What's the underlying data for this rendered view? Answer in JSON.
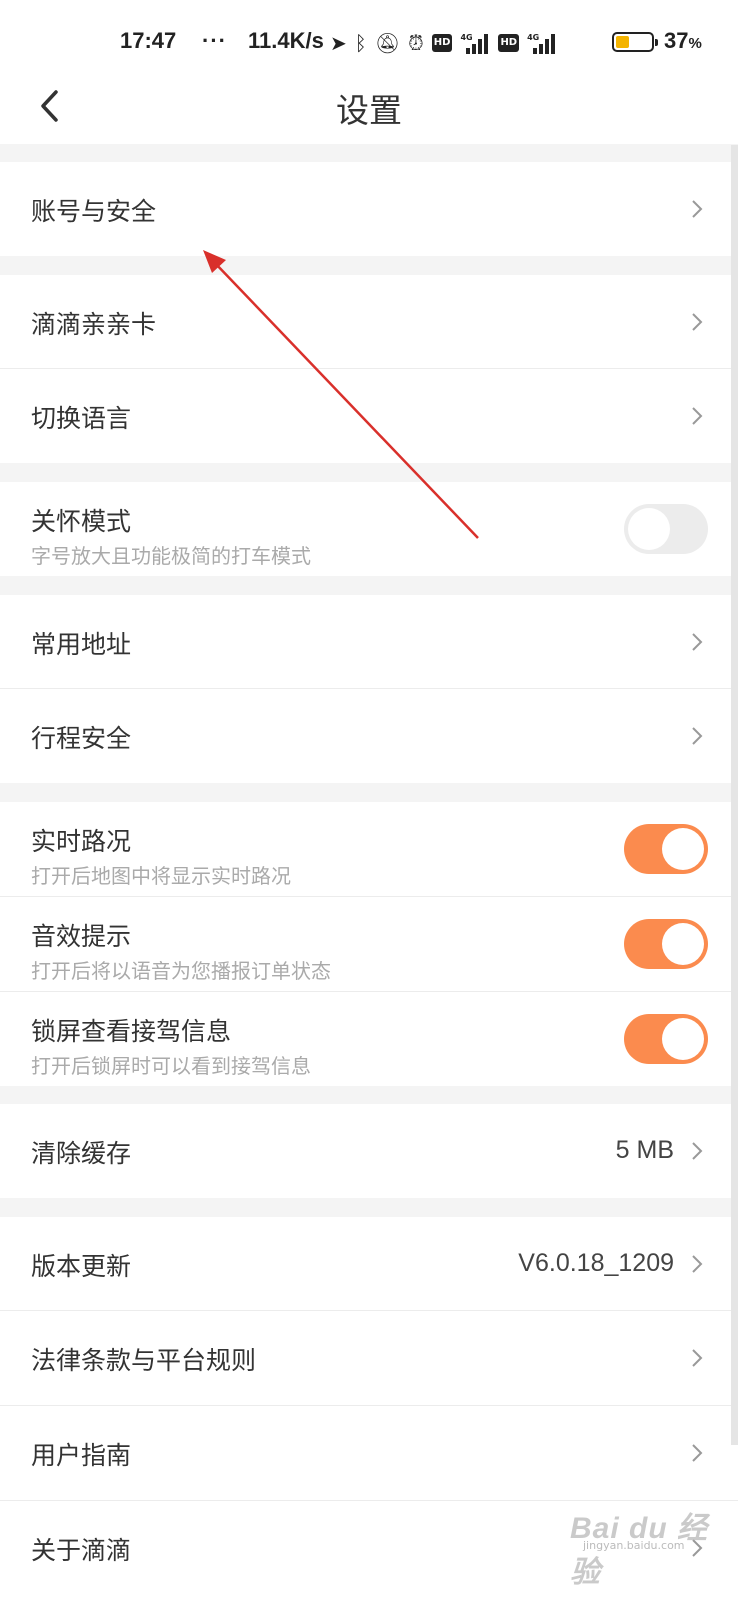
{
  "status_bar": {
    "time": "17:47",
    "dots": "···",
    "net_speed": "11.4K/s",
    "net_type_1": "4G",
    "net_type_2": "4G",
    "hd_label": "HD",
    "battery_pct": "37",
    "battery_unit": "%",
    "battery_level": 0.37,
    "battery_color": "#f4b400"
  },
  "header": {
    "title": "设置",
    "back_icon": "chevron-left-icon"
  },
  "settings": {
    "account_security": "账号与安全",
    "didi_card": "滴滴亲亲卡",
    "switch_language": "切换语言",
    "care_mode": {
      "label": "关怀模式",
      "desc": "字号放大且功能极简的打车模式",
      "enabled": false
    },
    "common_address": "常用地址",
    "trip_safety": "行程安全",
    "realtime_traffic": {
      "label": "实时路况",
      "desc": "打开后地图中将显示实时路况",
      "enabled": true
    },
    "sound_prompt": {
      "label": "音效提示",
      "desc": "打开后将以语音为您播报订单状态",
      "enabled": true
    },
    "lockscreen_info": {
      "label": "锁屏查看接驾信息",
      "desc": "打开后锁屏时可以看到接驾信息",
      "enabled": true
    },
    "clear_cache": {
      "label": "清除缓存",
      "value": "5 MB"
    },
    "version_update": {
      "label": "版本更新",
      "value": "V6.0.18_1209"
    },
    "legal_terms": "法律条款与平台规则",
    "user_guide": "用户指南",
    "about_didi": "关于滴滴"
  },
  "colors": {
    "toggle_on": "#fb8b4e",
    "toggle_off": "#ececec",
    "annotation_arrow": "#d9302b"
  },
  "watermark": {
    "text": "Bai du 经验",
    "sub": "jingyan.baidu.com"
  }
}
